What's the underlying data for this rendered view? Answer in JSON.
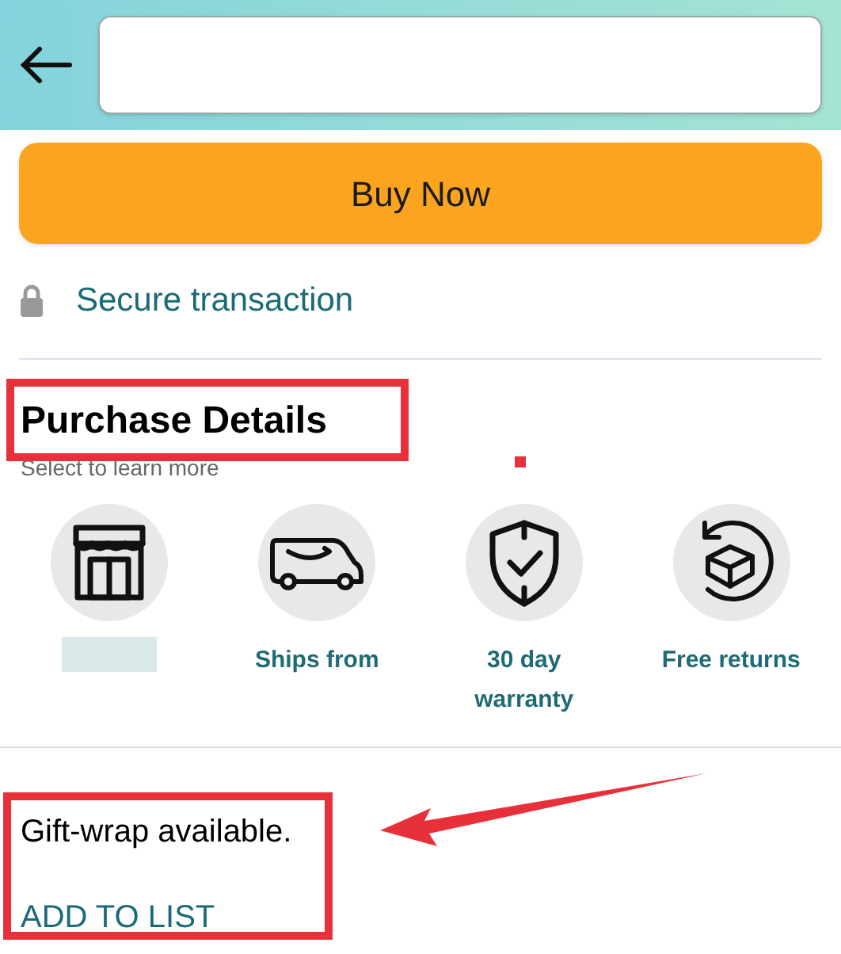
{
  "buy_button": "Buy Now",
  "secure": "Secure transaction",
  "purchase_details": {
    "title": "Purchase Details",
    "subtitle": "Select to learn more",
    "features": [
      {
        "kind": "store"
      },
      {
        "kind": "van",
        "lines": [
          "Ships from"
        ]
      },
      {
        "kind": "shield",
        "lines": [
          "30 day",
          "warranty"
        ]
      },
      {
        "kind": "returns",
        "lines": [
          "Free returns"
        ]
      }
    ]
  },
  "gift_wrap": "Gift-wrap available.",
  "add_to_list": "ADD TO LIST"
}
